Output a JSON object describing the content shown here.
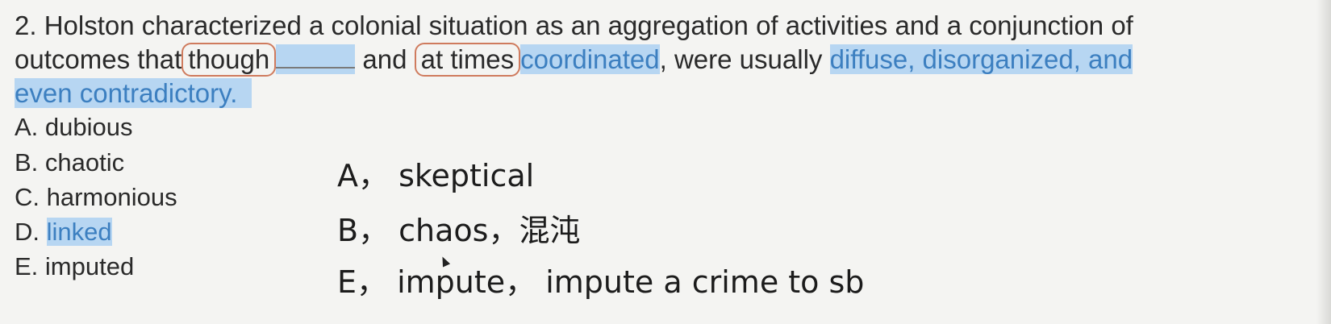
{
  "question": {
    "line1": "2. Holston characterized a colonial situation as an aggregation of activities and a conjunction of",
    "line2_a": "outcomes that",
    "line2_though": "though",
    "line2_and": " and ",
    "line2_attimes": "at times",
    "line2_coordinated": "coordinated",
    "line2_were": ", were usually ",
    "line2_diffuse": "diffuse, disorganized, and",
    "line3": "even contradictory."
  },
  "options": [
    {
      "letter": "A.",
      "text": "dubious"
    },
    {
      "letter": "B.",
      "text": "chaotic"
    },
    {
      "letter": "C.",
      "text": "harmonious"
    },
    {
      "letter": "D.",
      "text": "linked"
    },
    {
      "letter": "E.",
      "text": "imputed"
    }
  ],
  "notes": [
    "A， skeptical",
    "B， chaos，混沌",
    "E， impute， impute a crime to sb"
  ],
  "colors": {
    "highlight": "#b7d6f2",
    "highlight_text": "#3c7fc0",
    "circle": "#cf7b5e"
  }
}
